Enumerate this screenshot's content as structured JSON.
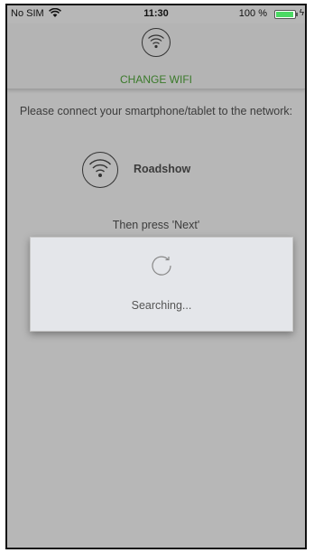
{
  "status_bar": {
    "carrier": "No SIM",
    "time": "11:30",
    "battery_percent": "100 %",
    "battery_level": 1.0
  },
  "header": {
    "icon": "wifi-circle-icon",
    "title": "CHANGE WIFI",
    "title_color": "#3a7a2a"
  },
  "content": {
    "instruction": "Please connect your smartphone/tablet to the network:",
    "network": {
      "icon": "wifi-circle-icon",
      "name": "Roadshow"
    },
    "then_press": "Then press 'Next'"
  },
  "modal": {
    "icon": "refresh-spinner-icon",
    "text": "Searching..."
  }
}
